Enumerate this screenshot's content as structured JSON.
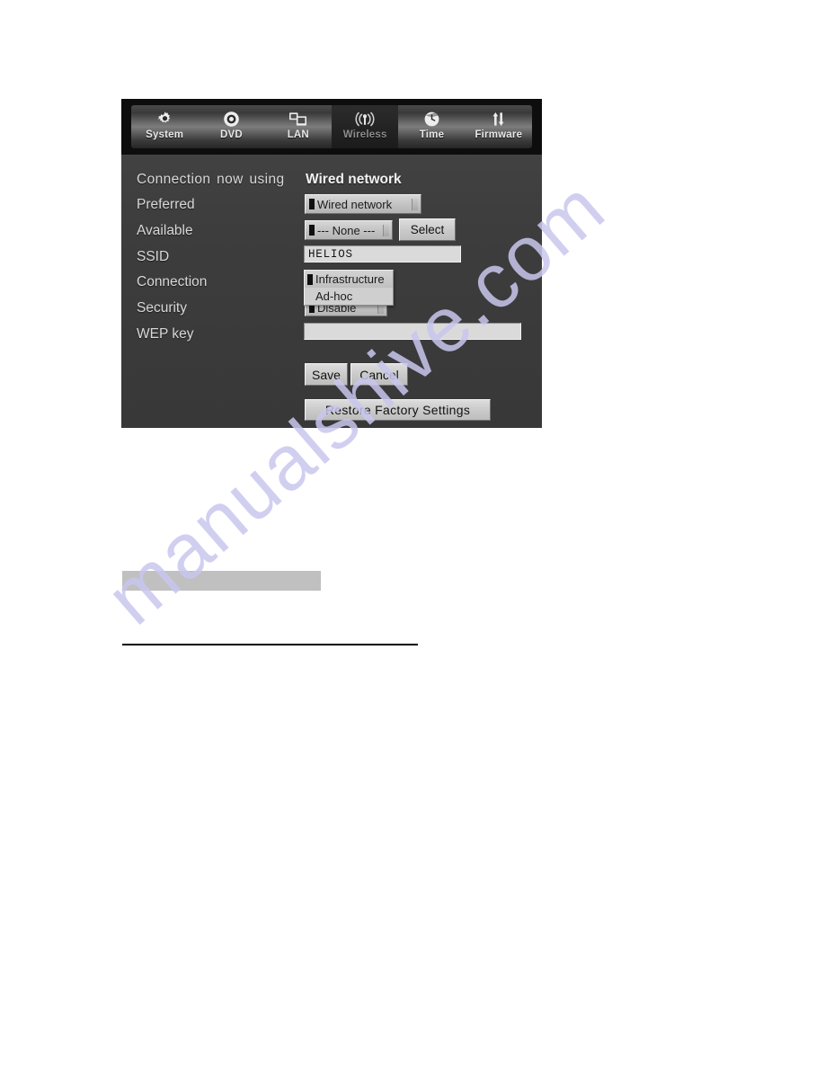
{
  "document": {
    "page_background": "#ffffff",
    "watermark_text": "manualshive.com",
    "watermark_color": "#c9c7ee"
  },
  "screenshot": {
    "panel_background": "#3f3f3f",
    "tab_bar": {
      "active_tab": "Wireless",
      "tabs": [
        {
          "label": "System",
          "icon": "gear-icon",
          "active": false
        },
        {
          "label": "DVD",
          "icon": "disc-icon",
          "active": false
        },
        {
          "label": "LAN",
          "icon": "network-icon",
          "active": false
        },
        {
          "label": "Wireless",
          "icon": "wireless-icon",
          "active": true
        },
        {
          "label": "Time",
          "icon": "clock-icon",
          "active": false
        },
        {
          "label": "Firmware",
          "icon": "updown-arrows-icon",
          "active": false
        }
      ]
    },
    "form": {
      "rows": {
        "connection_now_using": {
          "label": "Connection now using",
          "value": "Wired network"
        },
        "preferred": {
          "label": "Preferred",
          "value": "Wired network"
        },
        "available": {
          "label": "Available",
          "value": "--- None ---",
          "select_button": "Select"
        },
        "ssid": {
          "label": "SSID",
          "value": "HELIOS"
        },
        "connection": {
          "label": "Connection",
          "value": "Infrastructure",
          "options": [
            "Infrastructure",
            "Ad-hoc"
          ],
          "expanded": true
        },
        "security": {
          "label": "Security",
          "value": "Disable"
        },
        "wep_key": {
          "label": "WEP key",
          "value": ""
        }
      },
      "buttons": {
        "save": "Save",
        "cancel": "Cancel",
        "restore": "Restore Factory Settings"
      }
    }
  }
}
